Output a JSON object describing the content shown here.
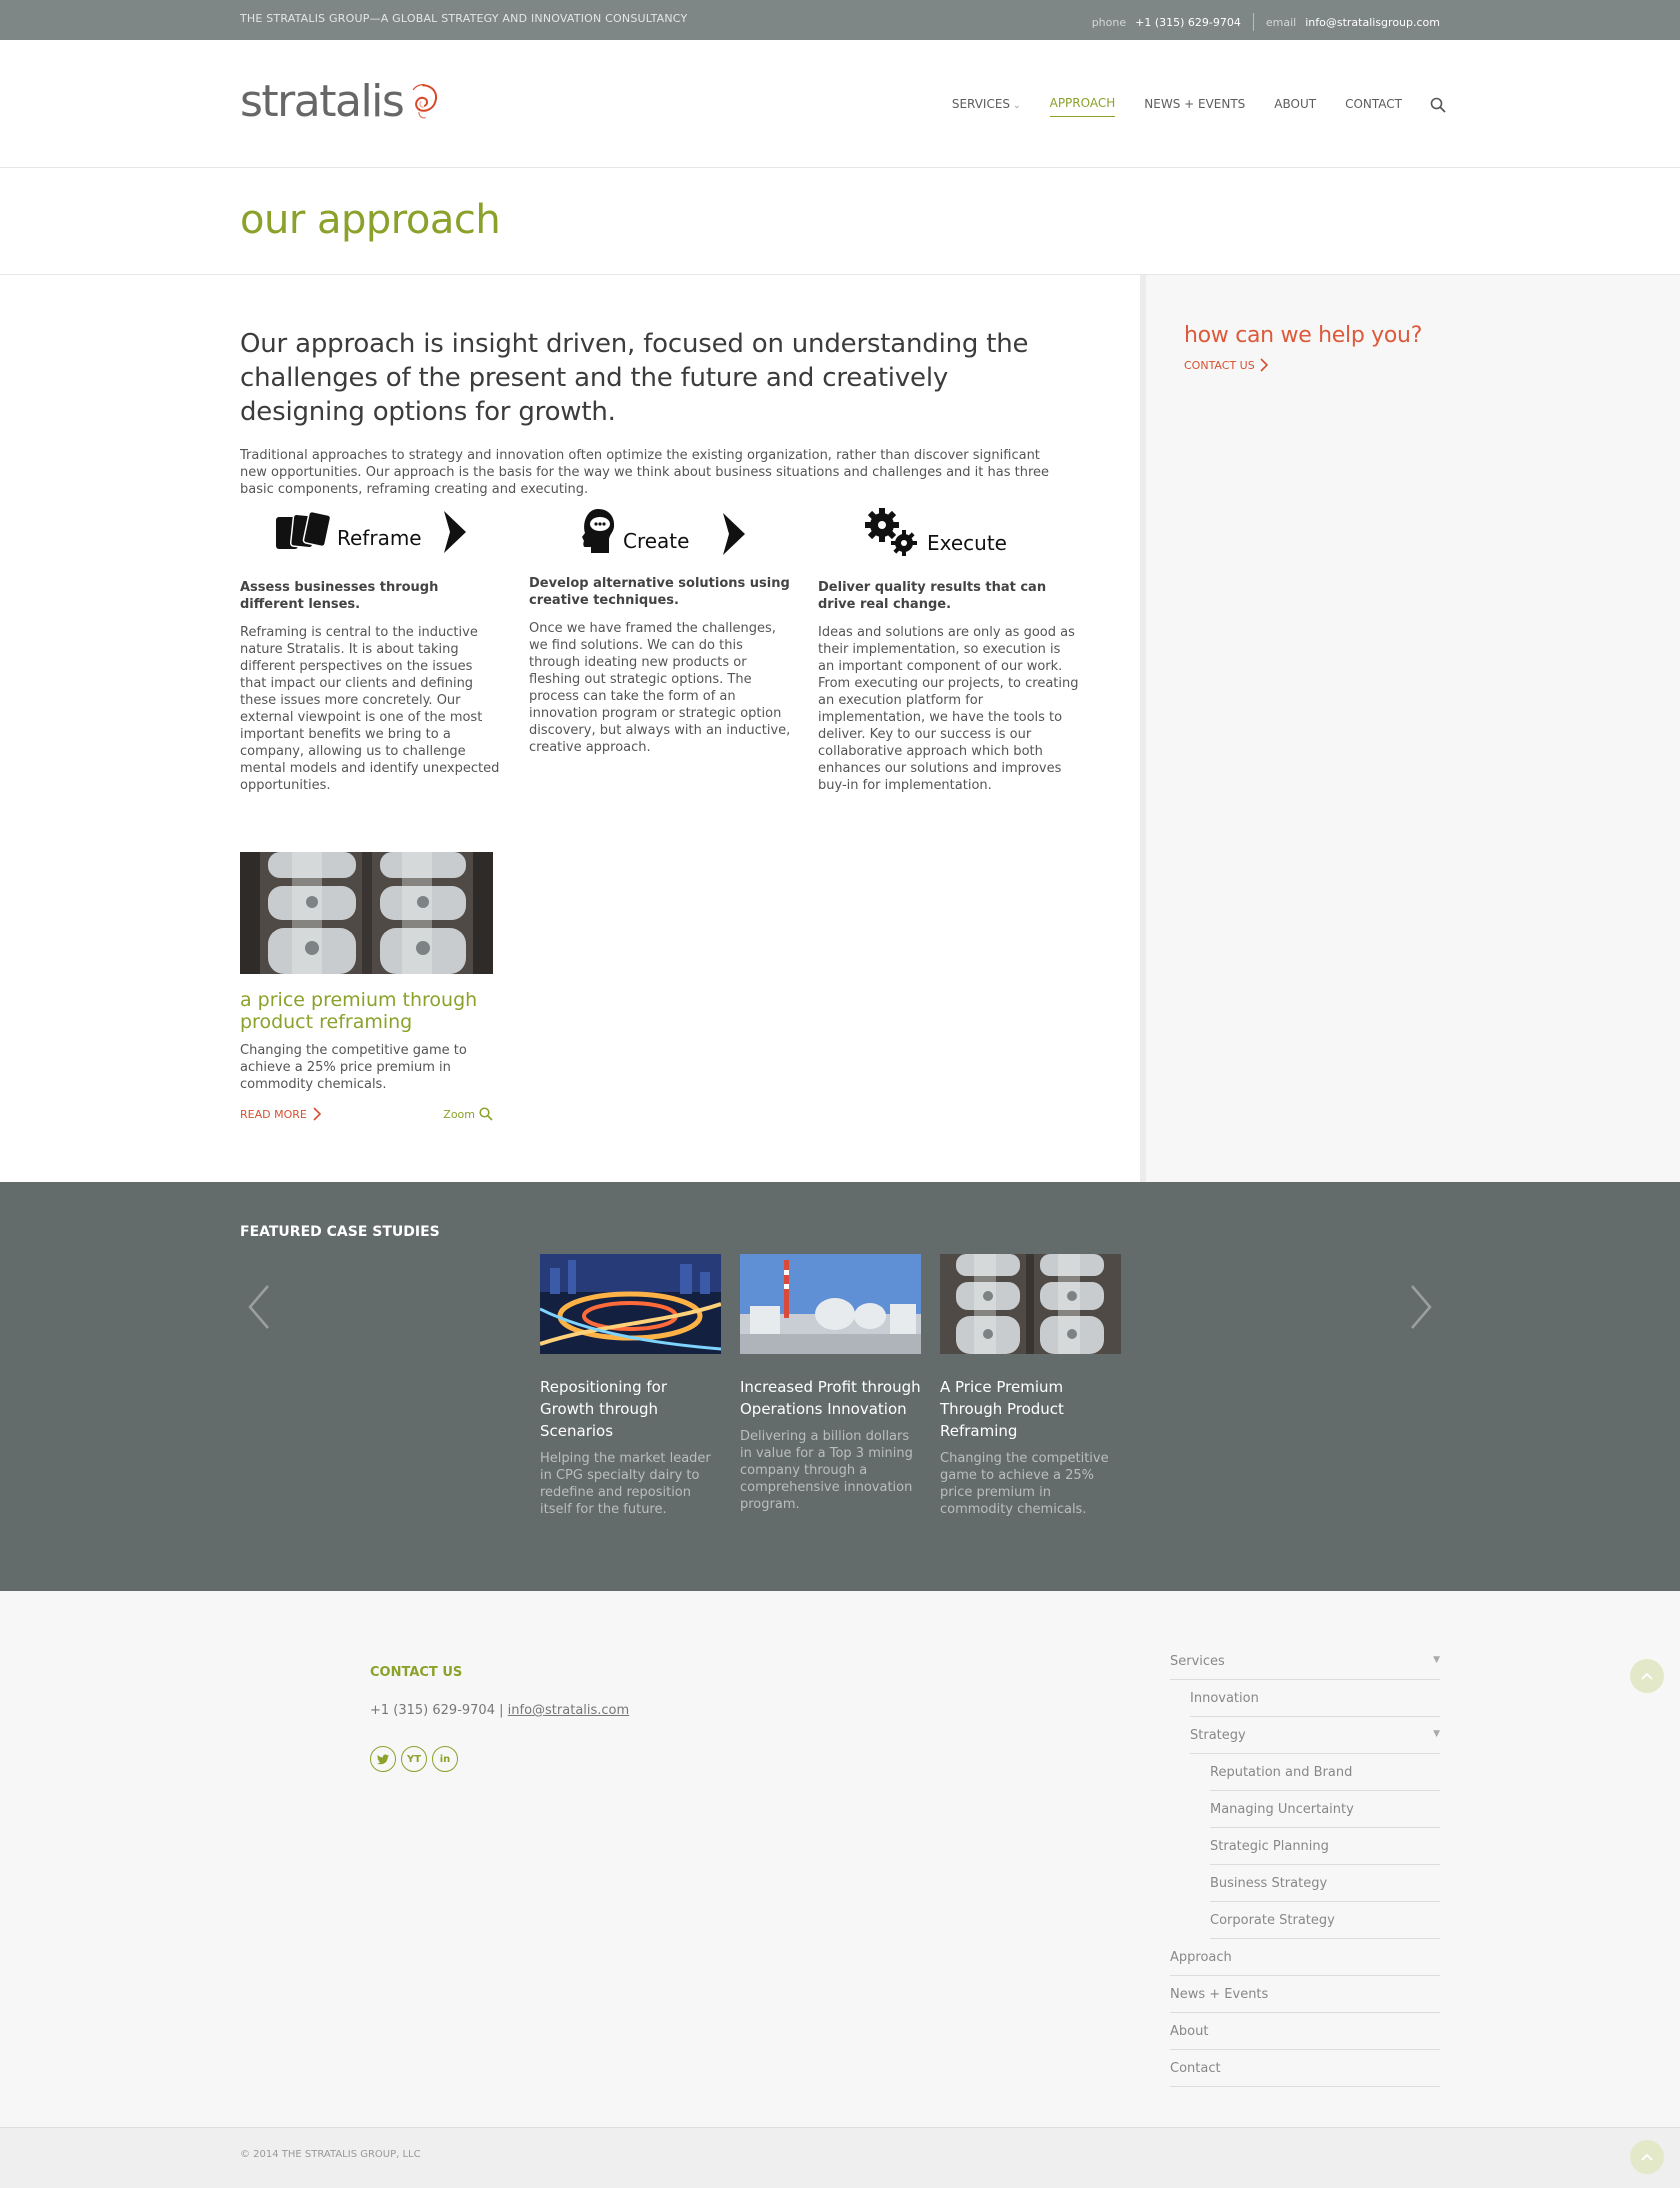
{
  "topbar": {
    "tagline": "THE STRATALIS GROUP—A GLOBAL STRATEGY AND INNOVATION CONSULTANCY",
    "phone_label": "phone",
    "phone": "+1 (315) 629-9704",
    "email_label": "email",
    "email": "info@stratalisgroup.com"
  },
  "header": {
    "logo_text": "stratalis",
    "nav": [
      {
        "label": "SERVICES"
      },
      {
        "label": "APPROACH"
      },
      {
        "label": "NEWS + EVENTS"
      },
      {
        "label": "ABOUT"
      },
      {
        "label": "CONTACT"
      }
    ],
    "active_nav": "APPROACH",
    "icons": {
      "search": "search-icon",
      "dropdown": "chevron-down-icon"
    }
  },
  "page": {
    "title": "our approach",
    "lead": "Our approach is insight driven, focused on understanding the challenges of the present and the future and creatively designing options for growth.",
    "intro": "Traditional approaches to strategy and innovation often optimize the existing organization, rather than discover significant new opportunities.  Our approach is the basis for the way we think about business situations and challenges and it has three basic components, reframing creating and executing.",
    "steps": [
      {
        "word": "Reframe",
        "heading": "Assess businesses through different lenses.",
        "body": "Reframing is central to the inductive nature Stratalis. It is about taking different perspectives on the issues that impact our clients and defining these issues more concretely.  Our external viewpoint is one of the most important benefits we bring to a company, allowing us to challenge mental models and identify unexpected opportunities."
      },
      {
        "word": "Create",
        "heading": "Develop alternative solutions using creative techniques.",
        "body": "Once we have framed the challenges, we find solutions.  We can do this through ideating new products or fleshing out strategic options.  The process can take the form of an innovation program or strategic option discovery, but always with an inductive, creative approach."
      },
      {
        "word": "Execute",
        "heading": "Deliver quality results that can drive real change.",
        "body": "Ideas and solutions are only as good as their implementation, so execution is an important component of our work.  From executing our projects, to creating an execution platform for implementation, we have the tools to deliver.  Key to our success is our collaborative approach which both enhances our solutions and improves buy-in for implementation."
      }
    ],
    "case": {
      "title": "a price premium through product reframing",
      "summary": "Changing the competitive game to achieve a 25% price premium in commodity chemicals.",
      "read_more": "READ MORE",
      "zoom": "Zoom"
    }
  },
  "sidebar": {
    "help": "how can we help you?",
    "cta": "CONTACT US"
  },
  "featured": {
    "heading": "FEATURED CASE STUDIES",
    "items": [
      {
        "title": "Repositioning for Growth through Scenarios",
        "summary": "Helping the market leader in CPG specialty dairy to redefine and reposition itself for the future."
      },
      {
        "title": "Increased Profit through Operations Innovation",
        "summary": "Delivering a billion dollars in value for a Top 3 mining company through a comprehensive innovation program."
      },
      {
        "title": "A Price Premium Through Product Reframing",
        "summary": "Changing the competitive game to achieve a 25% price premium in commodity chemicals."
      }
    ]
  },
  "footer": {
    "contact_title": "CONTACT US",
    "phone": "+1 (315) 629-9704",
    "separator": "|",
    "email": "info@stratalis.com",
    "social": [
      "twitter-icon",
      "YT",
      "in"
    ],
    "nav": [
      {
        "label": "Services",
        "level": 0
      },
      {
        "label": "Innovation",
        "level": 1
      },
      {
        "label": "Strategy",
        "level": 1
      },
      {
        "label": "Reputation and Brand",
        "level": 2
      },
      {
        "label": "Managing Uncertainty",
        "level": 2
      },
      {
        "label": "Strategic Planning",
        "level": 2
      },
      {
        "label": "Business Strategy",
        "level": 2
      },
      {
        "label": "Corporate Strategy",
        "level": 2
      },
      {
        "label": "Approach",
        "level": 0
      },
      {
        "label": "News + Events",
        "level": 0
      },
      {
        "label": "About",
        "level": 0
      },
      {
        "label": "Contact",
        "level": 0
      }
    ],
    "copyright": "© 2014 THE STRATALIS GROUP, LLC"
  },
  "colors": {
    "accent": "#8aa22b",
    "cta": "#d65030",
    "topbar": "#7f8686",
    "featured_bg": "#646b6b"
  }
}
